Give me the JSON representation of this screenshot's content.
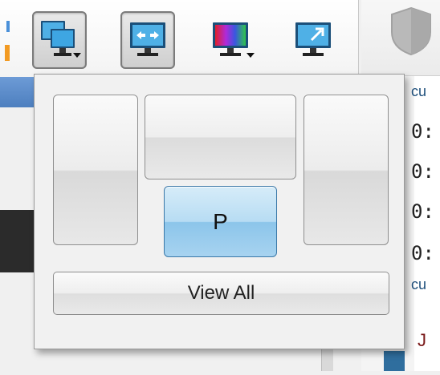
{
  "toolbar": {
    "buttons": [
      {
        "name": "multi-monitor-button",
        "icon": "multi-monitor-icon",
        "pressed": true,
        "has_dropdown": true
      },
      {
        "name": "extend-display-button",
        "icon": "extend-display-icon",
        "pressed": true,
        "has_dropdown": false
      },
      {
        "name": "color-settings-button",
        "icon": "color-monitor-icon",
        "pressed": false,
        "has_dropdown": true
      },
      {
        "name": "fullscreen-button",
        "icon": "expand-monitor-icon",
        "pressed": false,
        "has_dropdown": false
      }
    ]
  },
  "right_panel": {
    "shield_icon": "shield-icon",
    "rows": [
      "cu",
      "0:",
      "0:",
      "0:",
      "0:",
      "cu"
    ],
    "bottom_text": "J"
  },
  "popup": {
    "tiles": {
      "left": "",
      "top": "",
      "right": "",
      "primary": "P"
    },
    "view_all_label": "View All"
  },
  "colors": {
    "primary_tile": "#a7d3f0",
    "accent_blue": "#4a90d9",
    "accent_orange": "#f29a22"
  }
}
